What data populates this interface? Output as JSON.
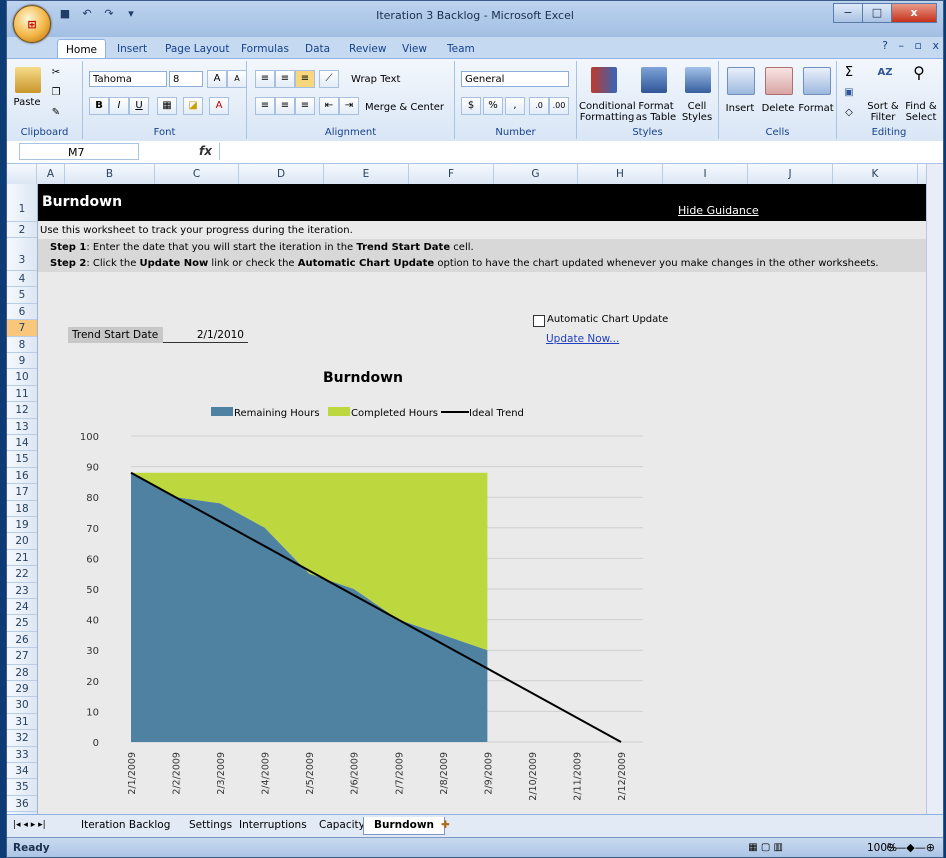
{
  "window": {
    "title": "Iteration 3 Backlog - Microsoft Excel",
    "office_button": "Office",
    "min": "−",
    "max": "□",
    "close": "x"
  },
  "ribbon_tabs": [
    "Home",
    "Insert",
    "Page Layout",
    "Formulas",
    "Data",
    "Review",
    "View",
    "Team"
  ],
  "ribbon": {
    "clipboard": {
      "label": "Clipboard",
      "paste": "Paste"
    },
    "font": {
      "label": "Font",
      "name": "Tahoma",
      "size": "8",
      "grow": "A",
      "shrink": "A",
      "bold": "B",
      "italic": "I",
      "underline": "U"
    },
    "alignment": {
      "label": "Alignment",
      "wrap": "Wrap Text",
      "merge": "Merge & Center"
    },
    "number": {
      "label": "Number",
      "format": "General",
      "currency": "$",
      "percent": "%",
      "comma": ","
    },
    "styles": {
      "label": "Styles",
      "cond": "Conditional",
      "cond2": "Formatting",
      "fmt_table": "Format",
      "fmt_table2": "as Table",
      "cell": "Cell",
      "cell2": "Styles"
    },
    "cells": {
      "label": "Cells",
      "insert": "Insert",
      "delete": "Delete",
      "format": "Format"
    },
    "editing": {
      "label": "Editing",
      "sort": "Sort &",
      "sort2": "Filter",
      "find": "Find &",
      "find2": "Select"
    }
  },
  "formula_bar": {
    "name_box": "M7",
    "fx": "fx",
    "value": ""
  },
  "columns": [
    "A",
    "B",
    "C",
    "D",
    "E",
    "F",
    "G",
    "H",
    "I",
    "J",
    "K"
  ],
  "rows": [
    "1",
    "2",
    "3",
    "4",
    "5",
    "6",
    "7",
    "8",
    "9",
    "10",
    "11",
    "12",
    "13",
    "14",
    "15",
    "16",
    "17",
    "18",
    "19",
    "20",
    "21",
    "22",
    "23",
    "24",
    "25",
    "26",
    "27",
    "28",
    "29",
    "30",
    "31",
    "32",
    "33",
    "34",
    "35",
    "36"
  ],
  "sheet": {
    "title": "Burndown",
    "hide_guidance": "Hide Guidance",
    "intro": "Use this worksheet to track your progress during the iteration.",
    "step1_label": "Step 1",
    "step1_a": ":  Enter the date that you will start the iteration in the ",
    "step1_b": "Trend Start Date",
    "step1_c": " cell.",
    "step2_label": "Step 2",
    "step2_a": ":  Click the ",
    "step2_b": "Update Now",
    "step2_c": " link or check the ",
    "step2_d": "Automatic Chart Update",
    "step2_e": " option to have the chart updated whenever you make changes in the other worksheets.",
    "trend_label": "Trend Start Date",
    "trend_value": "2/1/2010",
    "auto_update": "Automatic Chart Update",
    "update_now": "Update Now..."
  },
  "chart_data": {
    "type": "area",
    "title": "Burndown",
    "categories": [
      "2/1/2009",
      "2/2/2009",
      "2/3/2009",
      "2/4/2009",
      "2/5/2009",
      "2/6/2009",
      "2/7/2009",
      "2/8/2009",
      "2/9/2009",
      "2/10/2009",
      "2/11/2009",
      "2/12/2009"
    ],
    "ylim": [
      0,
      100
    ],
    "yticks": [
      0,
      10,
      20,
      30,
      40,
      50,
      60,
      70,
      80,
      90,
      100
    ],
    "legend": "top",
    "series": [
      {
        "name": "Remaining Hours",
        "values": [
          88,
          80,
          78,
          70,
          55,
          50,
          40,
          35,
          30
        ],
        "color": "#4f81a0"
      },
      {
        "name": "Completed Hours",
        "values": [
          0,
          8,
          10,
          18,
          33,
          38,
          48,
          53,
          58
        ],
        "color": "#bcd83e"
      },
      {
        "name": "Ideal Trend",
        "values": [
          88,
          80,
          72,
          64,
          56,
          48,
          40,
          32,
          24,
          16,
          8,
          0
        ],
        "color": "#000000"
      }
    ]
  },
  "sheet_tabs": [
    "Iteration Backlog",
    "Settings",
    "Interruptions",
    "Capacity",
    "Burndown"
  ],
  "status": {
    "ready": "Ready",
    "zoom": "100%"
  }
}
